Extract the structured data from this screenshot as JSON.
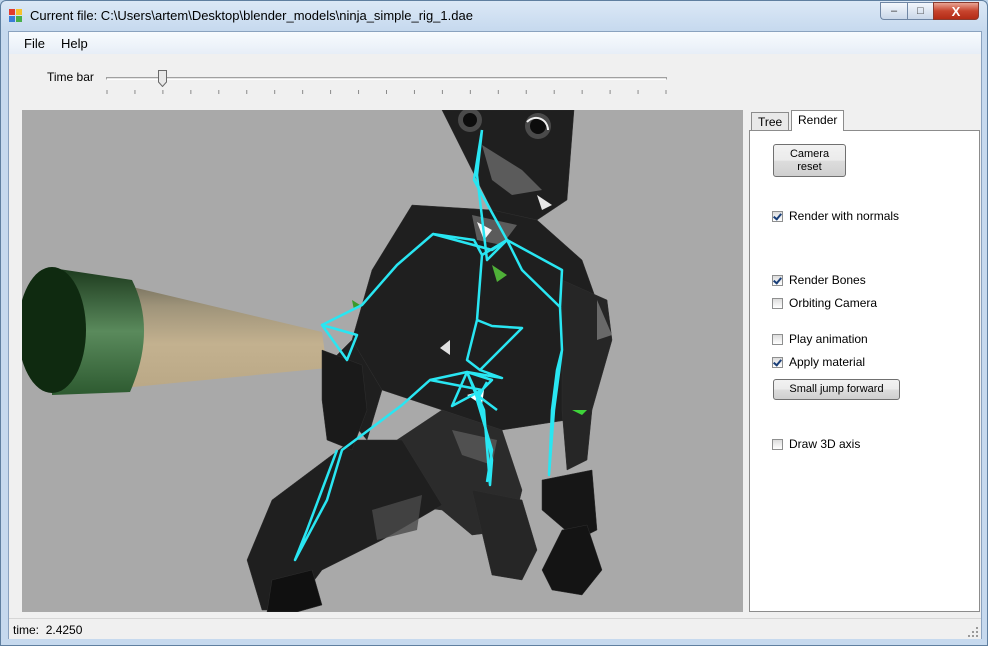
{
  "window": {
    "title": "Current file: C:\\Users\\artem\\Desktop\\blender_models\\ninja_simple_rig_1.dae",
    "minimize_label": "–",
    "maximize_label": "□",
    "close_label": "X"
  },
  "menu": {
    "file": "File",
    "help": "Help"
  },
  "timebar": {
    "label": "Time bar",
    "value_fraction": 0.1
  },
  "tabs": {
    "tree": "Tree",
    "render": "Render",
    "selected": "Render"
  },
  "render_panel": {
    "camera_reset_line1": "Camera",
    "camera_reset_line2": "reset",
    "render_with_normals": {
      "label": "Render with normals",
      "checked": true
    },
    "render_bones": {
      "label": "Render Bones",
      "checked": true
    },
    "orbiting_camera": {
      "label": "Orbiting Camera",
      "checked": false
    },
    "play_animation": {
      "label": "Play animation",
      "checked": false
    },
    "apply_material": {
      "label": "Apply material",
      "checked": true
    },
    "small_jump_forward": "Small jump forward",
    "draw_3d_axis": {
      "label": "Draw 3D axis",
      "checked": false
    }
  },
  "status": {
    "time_label": "time:",
    "time_value": "2.4250"
  },
  "colors": {
    "viewport_background": "#a9a9a9",
    "bone_color": "#29e6f2",
    "mesh_color": "#202020"
  },
  "icons": {
    "app": "app-icon",
    "resize_grip": "resize-grip-icon"
  }
}
